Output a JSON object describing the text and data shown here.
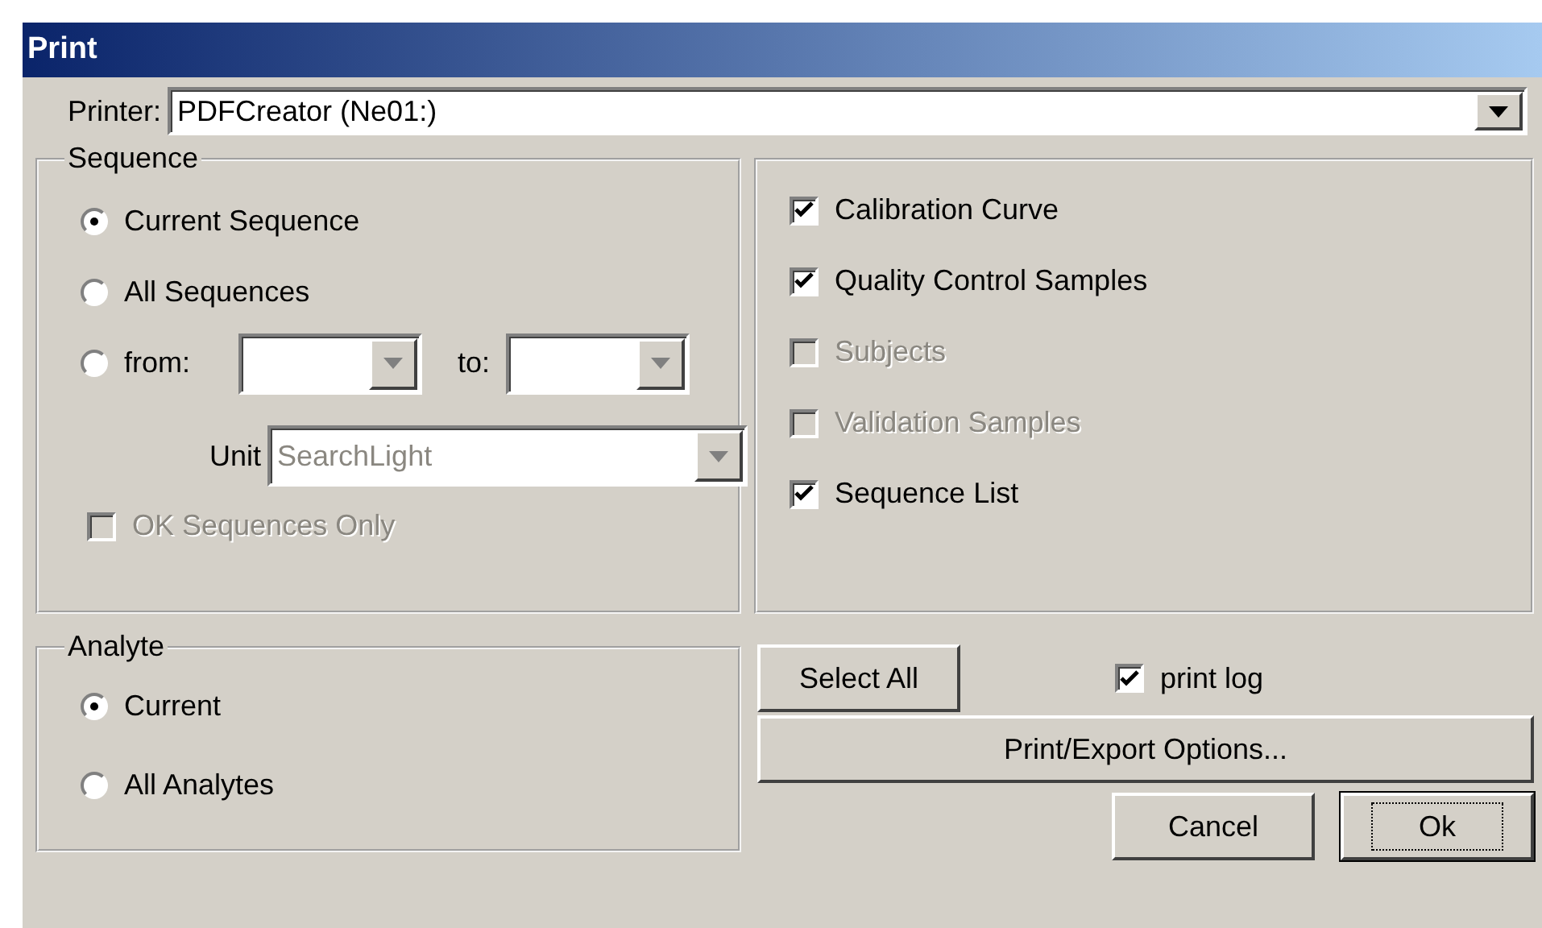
{
  "window": {
    "title": "Print"
  },
  "printer": {
    "label": "Printer:",
    "value": "PDFCreator (Ne01:)"
  },
  "sequence": {
    "title": "Sequence",
    "options": [
      {
        "label": "Current Sequence",
        "selected": true
      },
      {
        "label": "All Sequences",
        "selected": false
      },
      {
        "label": "from:",
        "selected": false
      }
    ],
    "range": {
      "to_label": "to:",
      "disabled": true
    },
    "unit": {
      "label": "Unit",
      "value": "SearchLight",
      "disabled": true
    },
    "ok_only": {
      "label": "OK Sequences Only",
      "checked": false,
      "disabled": true
    }
  },
  "reports": [
    {
      "label": "Calibration Curve",
      "checked": true,
      "disabled": false
    },
    {
      "label": "Quality Control Samples",
      "checked": true,
      "disabled": false
    },
    {
      "label": "Subjects",
      "checked": false,
      "disabled": true
    },
    {
      "label": "Validation Samples",
      "checked": false,
      "disabled": true
    },
    {
      "label": "Sequence List",
      "checked": true,
      "disabled": false
    }
  ],
  "analyte": {
    "title": "Analyte",
    "options": [
      {
        "label": "Current",
        "selected": true
      },
      {
        "label": "All Analytes",
        "selected": false
      }
    ]
  },
  "actions": {
    "select_all": "Select All",
    "print_log": {
      "label": "print log",
      "checked": true,
      "disabled": false
    },
    "options": "Print/Export Options...",
    "cancel": "Cancel",
    "ok": "Ok"
  }
}
